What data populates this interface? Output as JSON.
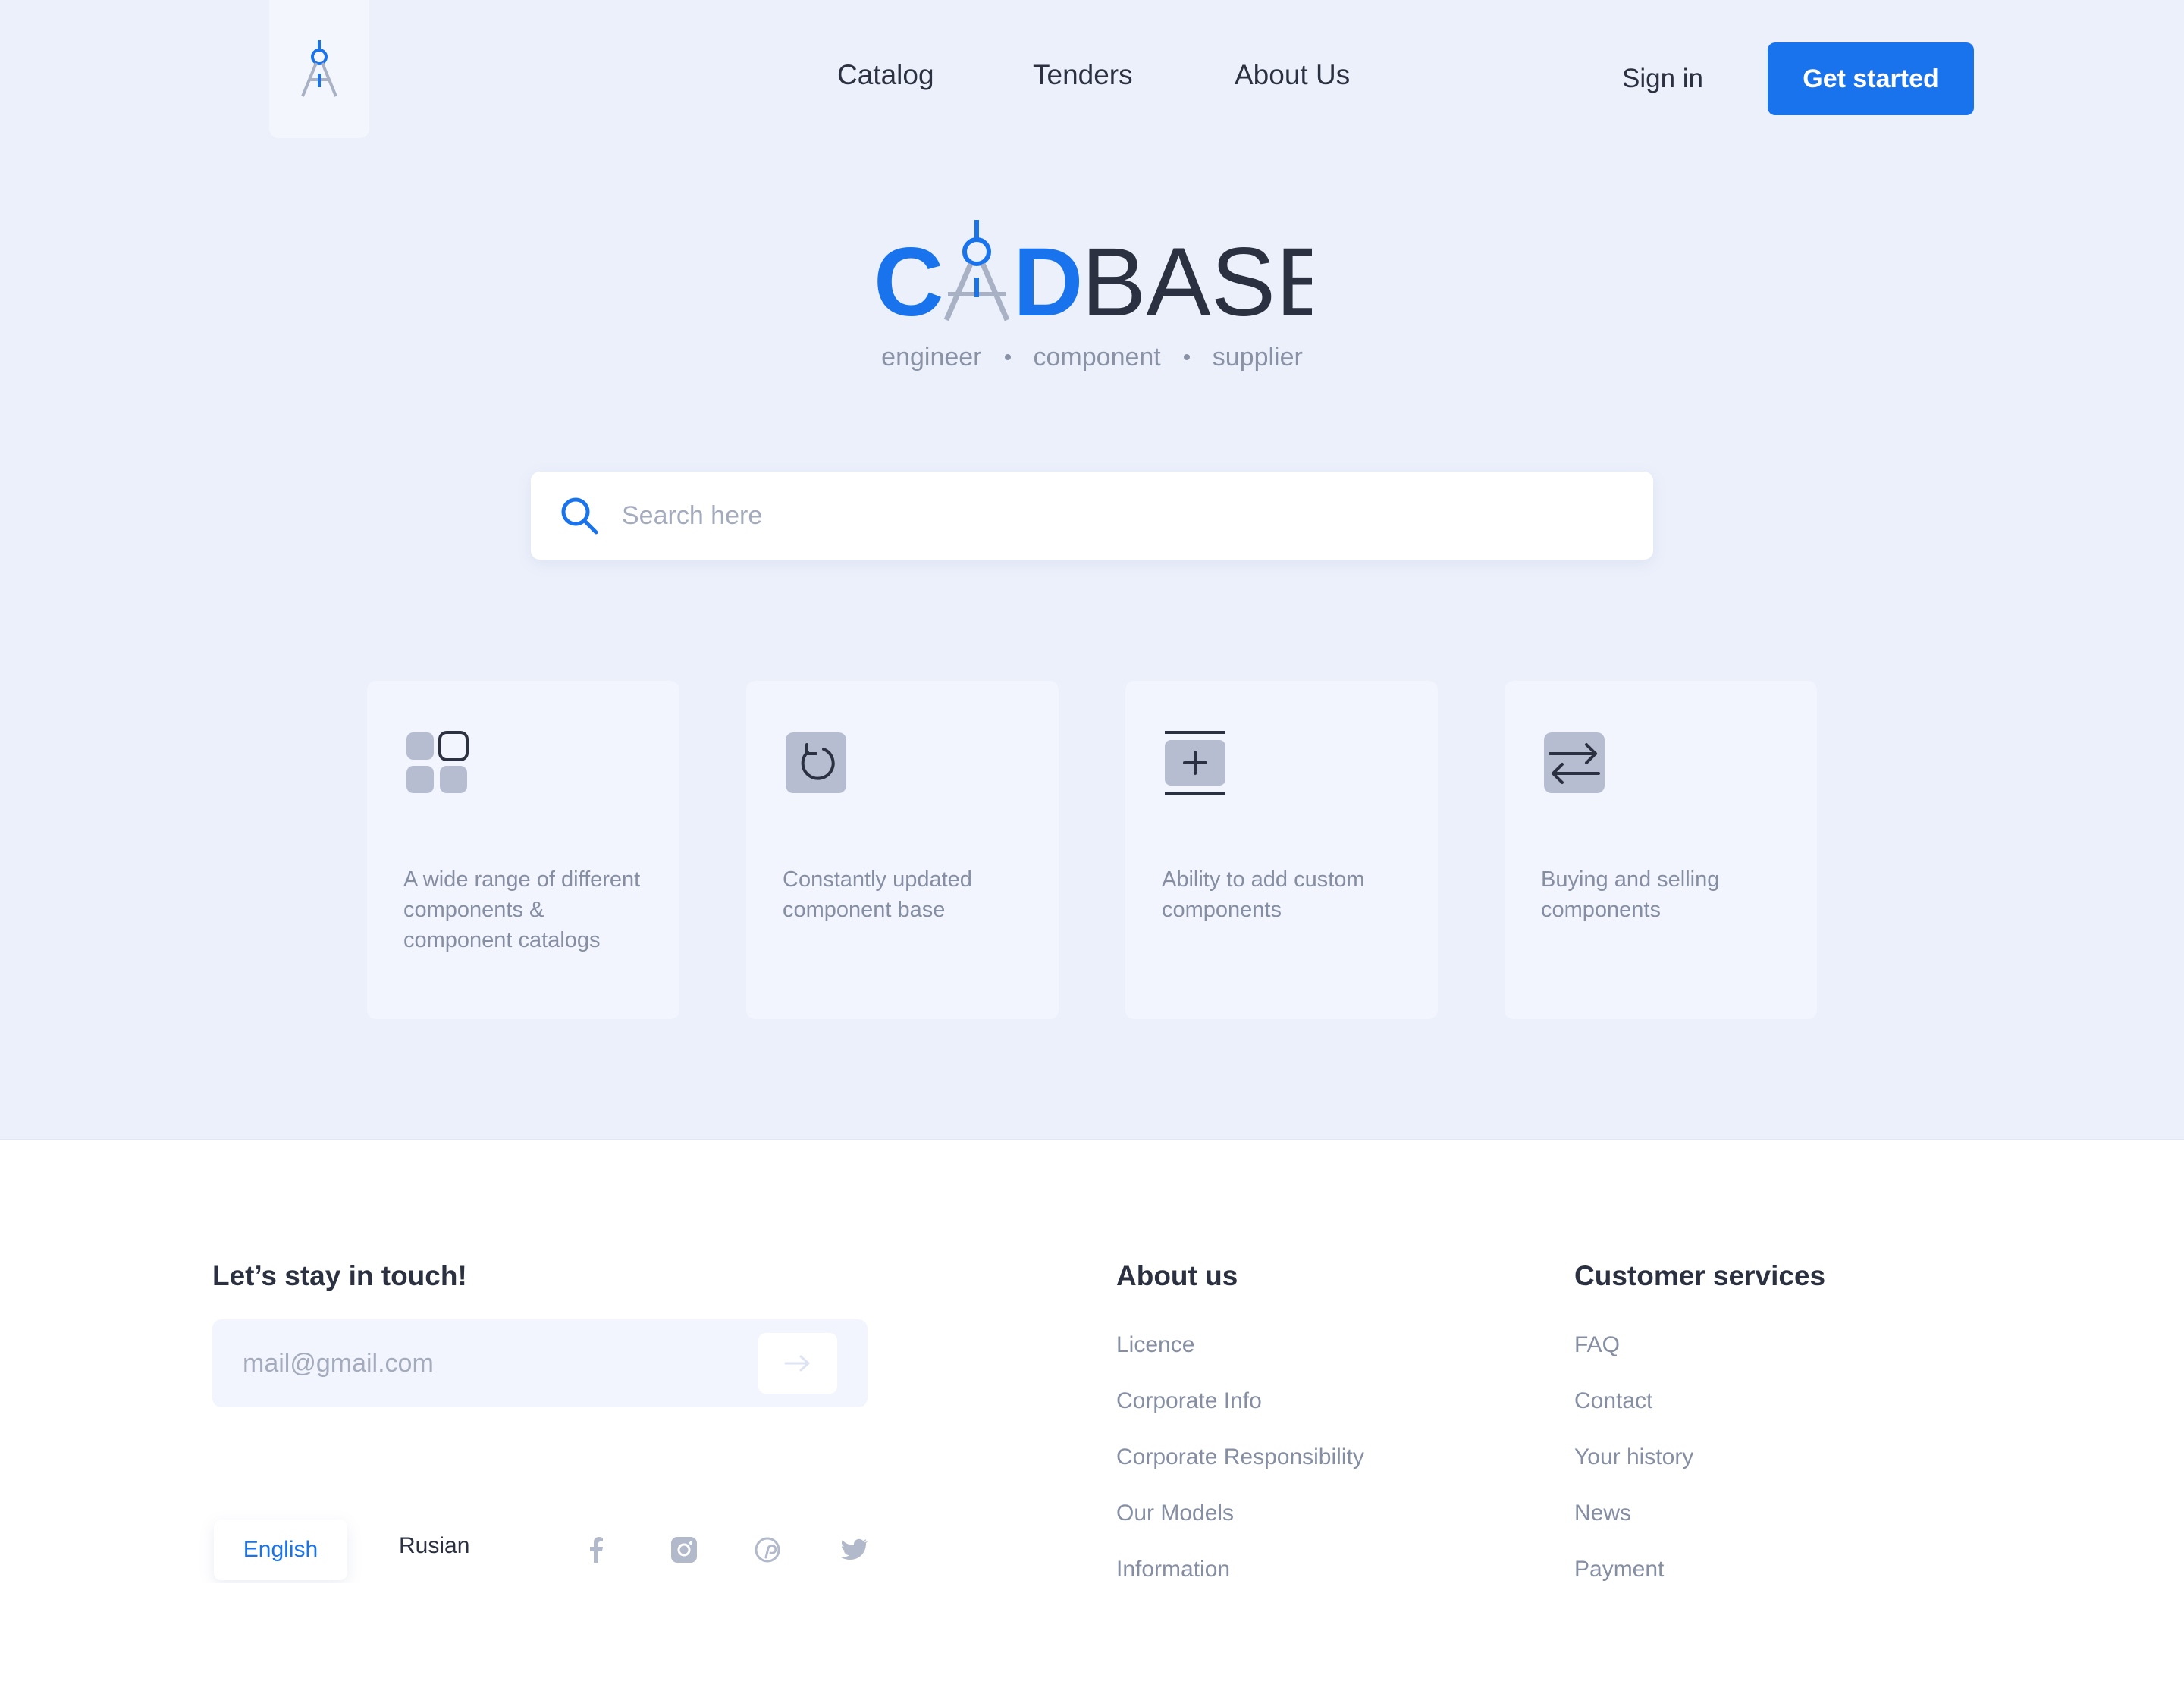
{
  "nav": {
    "links": [
      "Catalog",
      "Tenders",
      "About Us"
    ],
    "sign_in": "Sign in",
    "get_started": "Get started"
  },
  "brand": {
    "name_part1": "C",
    "name_part2": "D",
    "name_part3": "BASE",
    "tagline": [
      "engineer",
      "component",
      "supplier"
    ]
  },
  "search": {
    "placeholder": "Search here"
  },
  "features": [
    {
      "icon": "grid-icon",
      "text": "A wide range of different components & component catalogs"
    },
    {
      "icon": "refresh-icon",
      "text": "Constantly updated component base"
    },
    {
      "icon": "add-icon",
      "text": "Ability to add custom components"
    },
    {
      "icon": "exchange-icon",
      "text": "Buying and selling components"
    }
  ],
  "footer": {
    "newsletter_title": "Let’s stay in touch!",
    "email_placeholder": "mail@gmail.com",
    "languages": {
      "active": "English",
      "other": "Rusian"
    },
    "social_icons": [
      "facebook-icon",
      "instagram-icon",
      "pinterest-icon",
      "twitter-icon"
    ],
    "about": {
      "title": "About us",
      "links": [
        "Licence",
        "Corporate Info",
        "Corporate Responsibility",
        "Our Models",
        "Information"
      ]
    },
    "services": {
      "title": "Customer services",
      "links": [
        "FAQ",
        "Contact",
        "Your history",
        "News",
        "Payment"
      ]
    }
  },
  "colors": {
    "accent": "#1873ec",
    "hero_bg": "#ecf0fb",
    "card_bg": "#f2f5fd",
    "text_dark": "#2b3140",
    "text_muted": "#858ea2"
  }
}
